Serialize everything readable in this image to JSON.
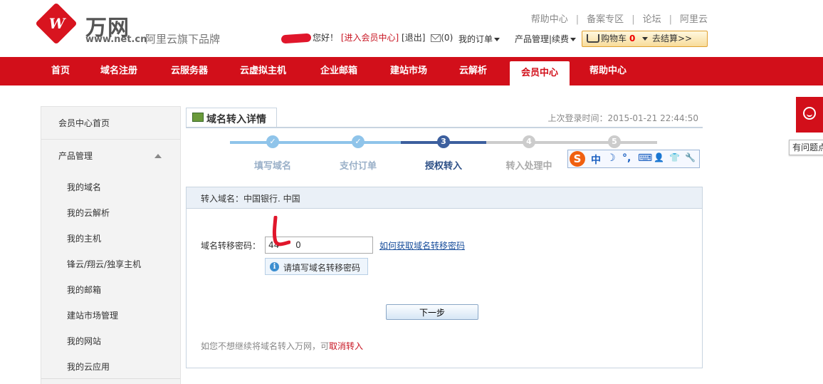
{
  "logo": {
    "mark": "W",
    "brand": "万网",
    "domain": "www.net.cn",
    "slogan": "阿里云旗下品牌"
  },
  "top_links": [
    "帮助中心",
    "备案专区",
    "论坛",
    "阿里云"
  ],
  "top_links_separator": "|",
  "user_bar": {
    "greeting": "您好！",
    "member_center_link": "[进入会员中心]",
    "logout_link": "[退出]",
    "mail_count": "(0)",
    "my_orders": "我的订单",
    "product_mgmt": "产品管理|续费"
  },
  "cart": {
    "label": "购物车",
    "count": "0",
    "checkout": "去结算>>"
  },
  "nav": {
    "items": [
      "首页",
      "域名注册",
      "云服务器",
      "云虚拟主机",
      "企业邮箱",
      "建站市场",
      "云解析",
      "会员中心",
      "帮助中心"
    ],
    "active": "会员中心"
  },
  "help_tab": {
    "label": "有问题点"
  },
  "sidebar": {
    "home": "会员中心首页",
    "group": "产品管理",
    "items": [
      "我的域名",
      "我的云解析",
      "我的主机",
      "锋云/翔云/独享主机",
      "我的邮箱",
      "建站市场管理",
      "我的网站",
      "我的云应用"
    ]
  },
  "page": {
    "tab_title": "域名转入详情",
    "last_login": "上次登录时间：2015-01-21 22:44:50"
  },
  "steps": {
    "labels": [
      "填写域名",
      "支付订单",
      "授权转入",
      "转入处理中",
      ""
    ],
    "numbers": [
      "✓",
      "✓",
      "3",
      "4",
      "5"
    ],
    "current": 3,
    "colors": {
      "done": "#8fc4ea",
      "current": "#3c5f9e",
      "todo": "#cccccc"
    }
  },
  "ime_toolbar": {
    "logo": "S",
    "mode": "中",
    "glyphs": [
      "☽",
      "°,",
      "⌨",
      "👤",
      "👕",
      "🔧"
    ]
  },
  "form": {
    "header": "转入域名：中国银行. 中国",
    "code_label": "域名转移密码：",
    "code_value": "44      0",
    "howto_link": "如何获取域名转移密码",
    "hint": "请填写域名转移密码",
    "next_button": "下一步",
    "footer_prefix": "如您不想继续将域名转入万网，可",
    "footer_link": "取消转入"
  }
}
